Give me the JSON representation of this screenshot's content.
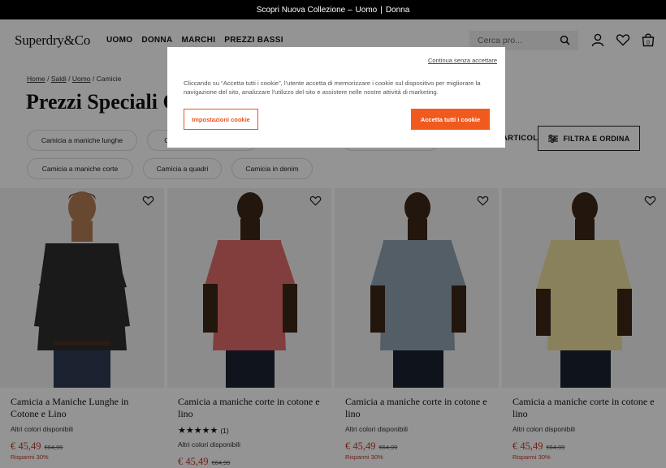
{
  "topbar": {
    "text": "Scopri Nuova Collezione  –",
    "link_uomo": "Uomo",
    "sep": "|",
    "link_donna": "Donna"
  },
  "header": {
    "logo": "Superdry&Co",
    "nav": [
      "UOMO",
      "DONNA",
      "MARCHI",
      "PREZZI BASSI"
    ],
    "search_placeholder": "Cerca pro...",
    "bag_count": "0"
  },
  "breadcrumb": {
    "home": "Home",
    "saldi": "Saldi",
    "uomo": "Uomo",
    "current": "Camicie",
    "sep": "/"
  },
  "page_title": "Prezzi Speciali Camicie",
  "chips": [
    "Camicia a maniche lunghe",
    "Camicia a maniche corte",
    "Camicia a quadri",
    "Camicia in denim",
    "Camicia Oxford"
  ],
  "toolbar": {
    "articoli": "ARTICOLI",
    "filter_label": "FILTRA E ORDINA"
  },
  "products": [
    {
      "name": "Camicia a Maniche Lunghe in Cotone e Lino",
      "availability": "Altri colori disponibili",
      "price": "€ 45,49",
      "old_price": "€64,99",
      "saving": "Risparmi 30%",
      "shirt_color": "#2c2e2b",
      "long_sleeve": true
    },
    {
      "name": "Camicia a maniche corte in cotone e lino",
      "stars": "★★★★★",
      "reviews": "(1)",
      "availability": "Altri colori disponibili",
      "price": "€ 45,49",
      "old_price": "€64,99",
      "shirt_color": "#e06b6a",
      "long_sleeve": false
    },
    {
      "name": "Camicia a maniche corte in cotone e lino",
      "availability": "Altri colori disponibili",
      "price": "€ 45,49",
      "old_price": "€64,99",
      "saving": "Risparmi 30%",
      "shirt_color": "#8fa3b2",
      "long_sleeve": false
    },
    {
      "name": "Camicia a maniche corte in cotone e lino",
      "availability": "Altri colori disponibili",
      "price": "€ 45,49",
      "old_price": "€64,99",
      "saving": "Risparmi 30%",
      "shirt_color": "#ecdf9d",
      "long_sleeve": false
    }
  ],
  "cookie": {
    "skip": "Continua senza accettare",
    "message": "Cliccando su “Accetta tutti i cookie”, l'utente accetta di memorizzare i cookie sul dispositivo per migliorare la navigazione del sito, analizzare l'utilizzo del sito e assistere nelle nostre attività di marketing.",
    "settings_label": "Impostazioni cookie",
    "accept_label": "Accetta tutti i cookie"
  },
  "colors": {
    "accent": "#f15a1f",
    "sale": "#c0392b"
  }
}
